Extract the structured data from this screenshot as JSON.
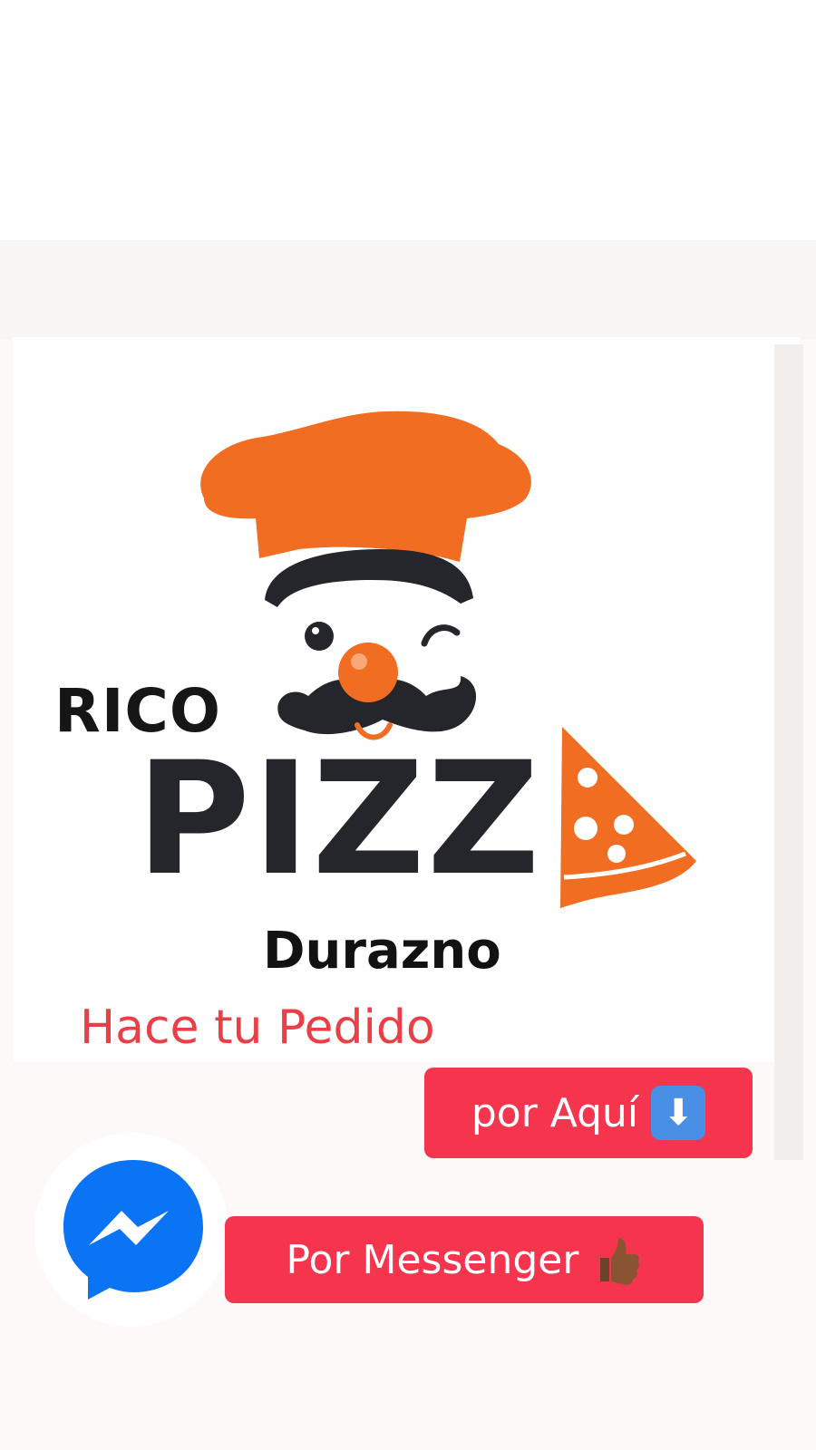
{
  "brand": {
    "line1": "RICO",
    "line2": "PIZZ",
    "city": "Durazno"
  },
  "cta": {
    "title": "Hace tu Pedido",
    "button_aqui": "por Aquí",
    "button_messenger": "Por Messenger"
  },
  "icons": {
    "chef": "chef-mascot-icon",
    "pizza": "pizza-slice-icon",
    "arrow": "arrow-down-emoji",
    "thumb": "thumbs-up-emoji",
    "messenger": "messenger-icon"
  },
  "colors": {
    "brand_orange": "#f06d22",
    "brand_dark": "#25262b",
    "cta_red": "#ea3f47",
    "pill_red": "#f5354e",
    "messenger_blue": "#0b74f5"
  }
}
